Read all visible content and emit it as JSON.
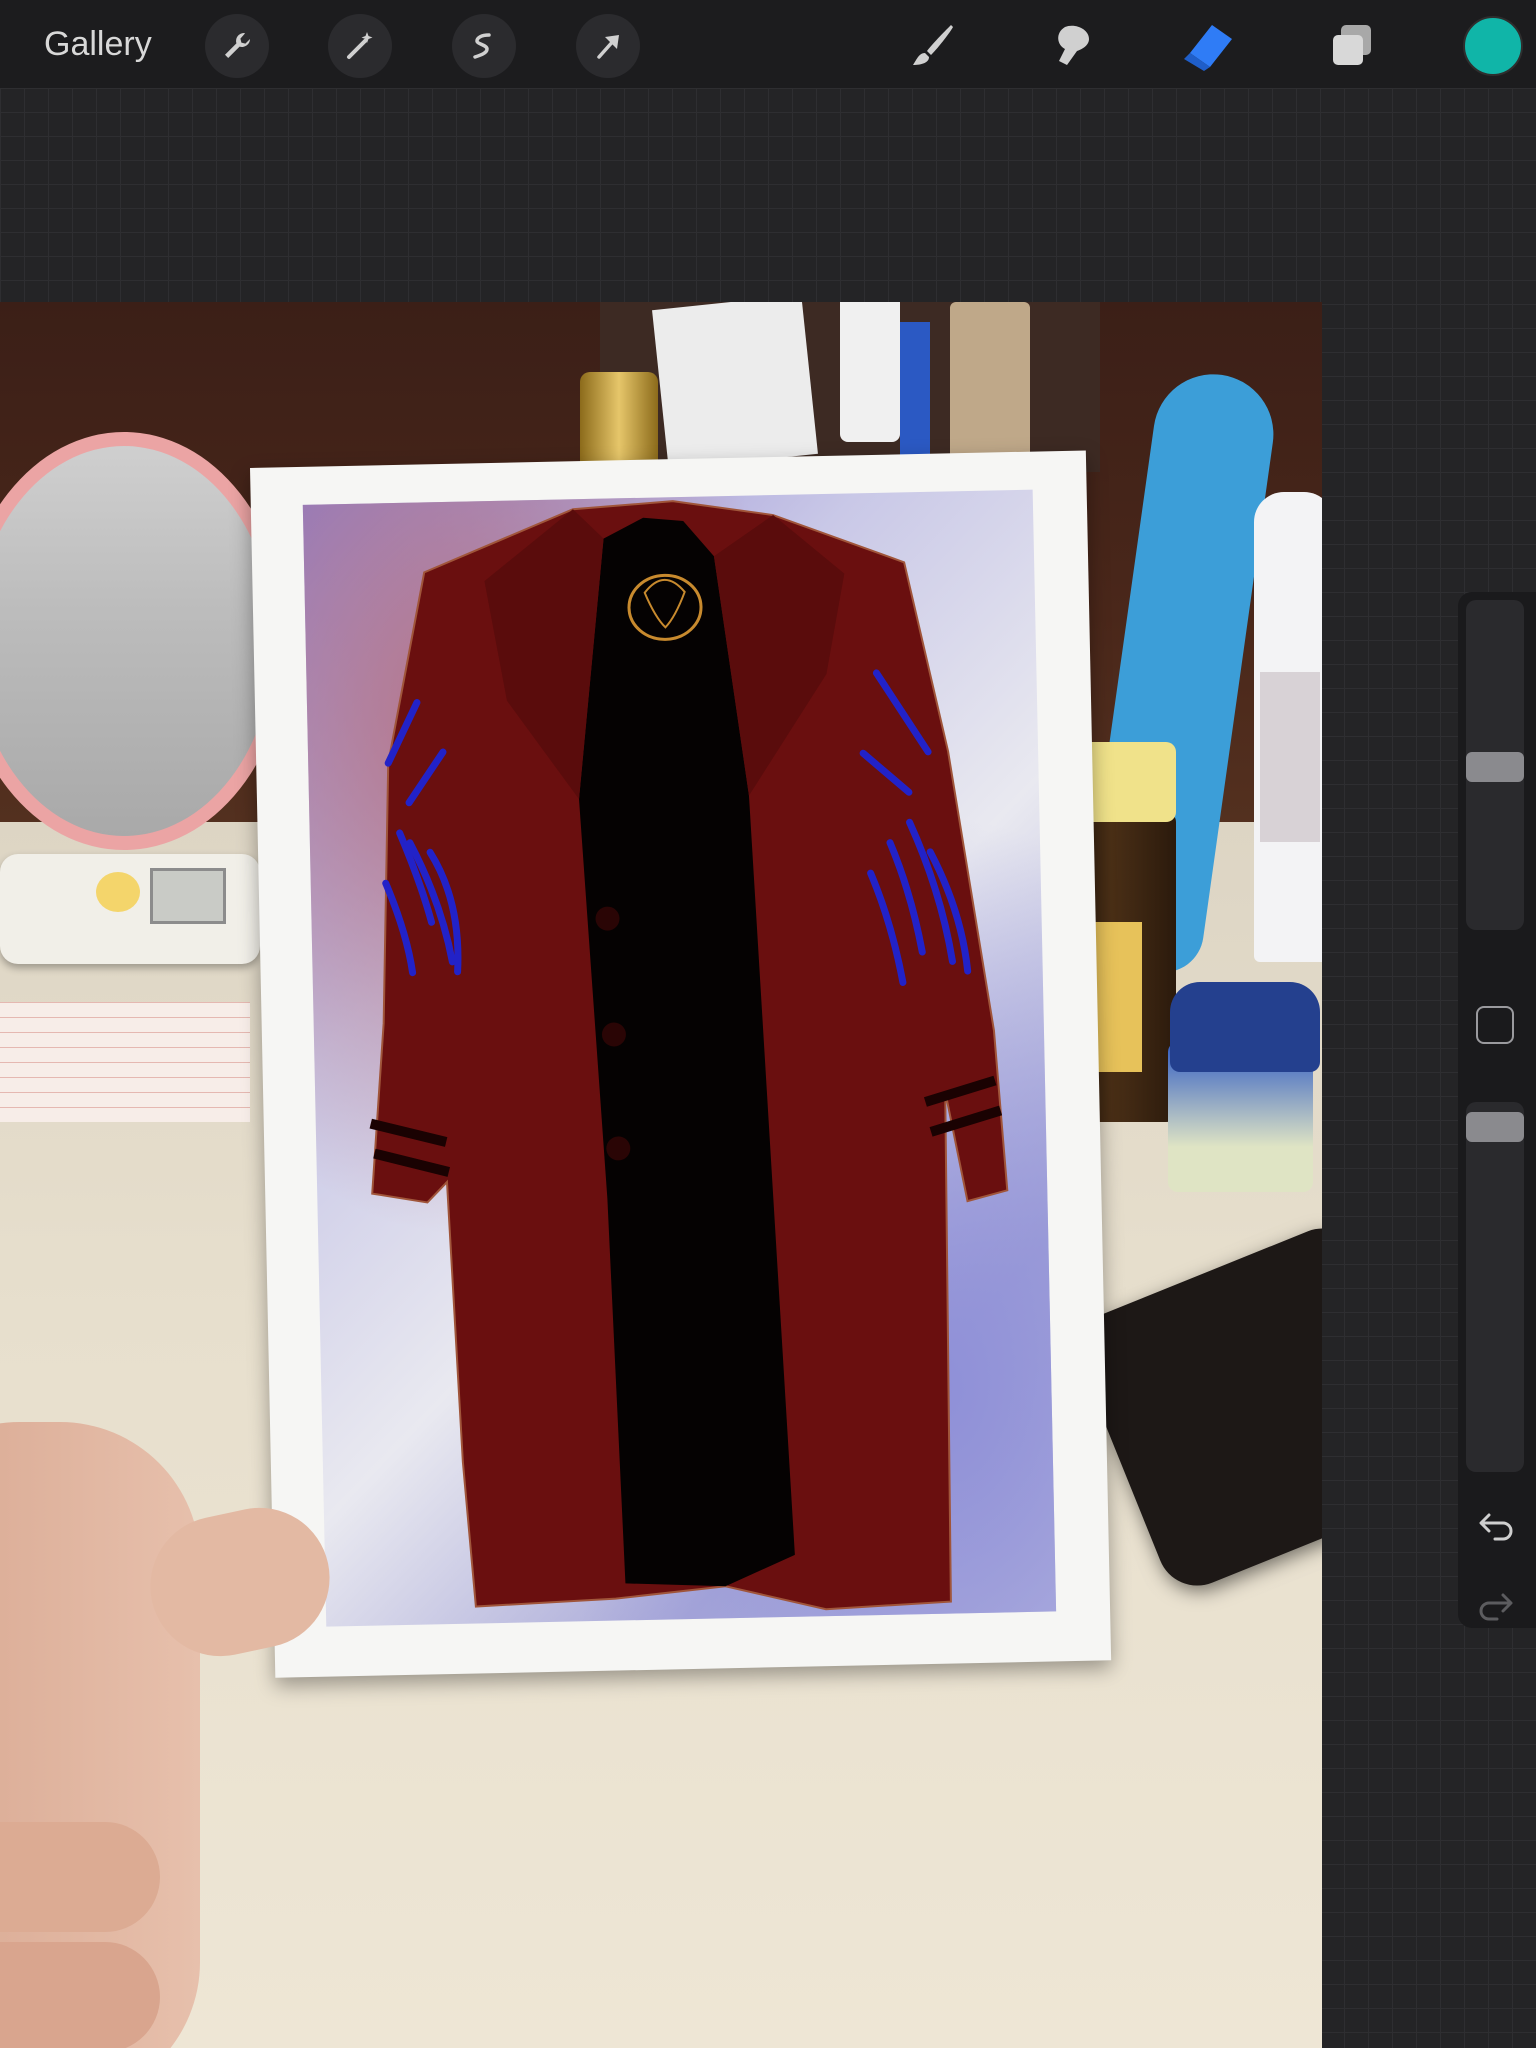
{
  "toolbar": {
    "gallery_label": "Gallery",
    "left_tools": [
      "wrench-icon",
      "magic-wand-icon",
      "selection-icon",
      "transform-arrow-icon"
    ],
    "right_tools": [
      "brush-icon",
      "smudge-icon",
      "eraser-icon",
      "layers-icon"
    ],
    "active_tool": "eraser-icon",
    "active_tool_color": "#2f7cf6",
    "current_color": "#10b5a8"
  },
  "canvas": {
    "description_icon": "photo-of-card-with-red-coat-drawing"
  },
  "sidebar": {
    "brush_size_level": 0.5,
    "opacity_level": 0.04,
    "modify_button": "square-modify-icon",
    "undo": "undo-icon",
    "redo": "redo-icon"
  }
}
